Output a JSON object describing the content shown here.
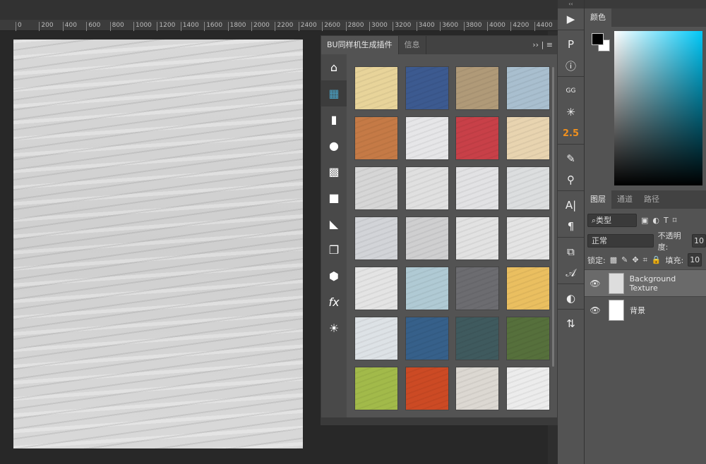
{
  "ruler": {
    "labels": [
      "0",
      "0",
      "200",
      "400",
      "600",
      "800",
      "1000",
      "1200",
      "1400",
      "1600",
      "1800",
      "2000",
      "2200",
      "2400",
      "2600",
      "2800",
      "3000",
      "3200",
      "3400",
      "3600",
      "3800",
      "4000",
      "4200",
      "4400"
    ]
  },
  "plugin": {
    "tabs": [
      "BU同样机生成插件",
      "信息"
    ],
    "menu": "›› | ≡",
    "side_icons": [
      {
        "name": "home-icon",
        "glyph": "⌂"
      },
      {
        "name": "texture-grid-icon",
        "glyph": "▦"
      },
      {
        "name": "document-icon",
        "glyph": "▮"
      },
      {
        "name": "drop-icon",
        "glyph": "●"
      },
      {
        "name": "checker-icon",
        "glyph": "▩"
      },
      {
        "name": "shape-icon",
        "glyph": "■"
      },
      {
        "name": "scroll-icon",
        "glyph": "◣"
      },
      {
        "name": "frame-icon",
        "glyph": "❐"
      },
      {
        "name": "cube-icon",
        "glyph": "⬢"
      },
      {
        "name": "fx-icon",
        "glyph": "fx"
      },
      {
        "name": "sun-icon",
        "glyph": "☀"
      }
    ],
    "tiles": [
      "#e8d49a",
      "#3c5a90",
      "#b09a78",
      "#a9bfcf",
      "#c57a46",
      "#e6e6e8",
      "#c84048",
      "#e8d4b0",
      "#d6d6d6",
      "#e0e0e0",
      "#e2e2e4",
      "#dcdedf",
      "#d2d4d8",
      "#cfcfd0",
      "#e2e2e2",
      "#e4e4e4",
      "#e4e4e4",
      "#b0cad4",
      "#6c6c70",
      "#eabf60",
      "#dde2e6",
      "#36608a",
      "#3f5a5e",
      "#56703c",
      "#a2ba4a",
      "#cc4a24",
      "#dcd8d2",
      "#ececec"
    ]
  },
  "strip": {
    "collapse": "‹‹",
    "icons": [
      "▶",
      "P",
      "ⓘ",
      "GG",
      "✳",
      "2.5",
      "✎",
      "⚲",
      "A|",
      "¶",
      "⧉",
      "𝒜",
      "◐",
      "⇅"
    ]
  },
  "color": {
    "tab": "颜色",
    "fg": "#000000",
    "bg": "#ffffff"
  },
  "layers": {
    "tabs": [
      "图层",
      "通道",
      "路径"
    ],
    "filter": "⌕类型",
    "filter_icons": [
      "▣",
      "◐",
      "T",
      "⌑"
    ],
    "blend": "正常",
    "opacity_label": "不透明度:",
    "opacity": "10",
    "lock_label": "锁定:",
    "lock_icons": [
      "▩",
      "✎",
      "✥",
      "⌗",
      "🔒"
    ],
    "fill_label": "填充:",
    "fill": "10",
    "items": [
      {
        "name": "Background Texture",
        "active": true
      },
      {
        "name": "背景",
        "active": false
      }
    ]
  }
}
